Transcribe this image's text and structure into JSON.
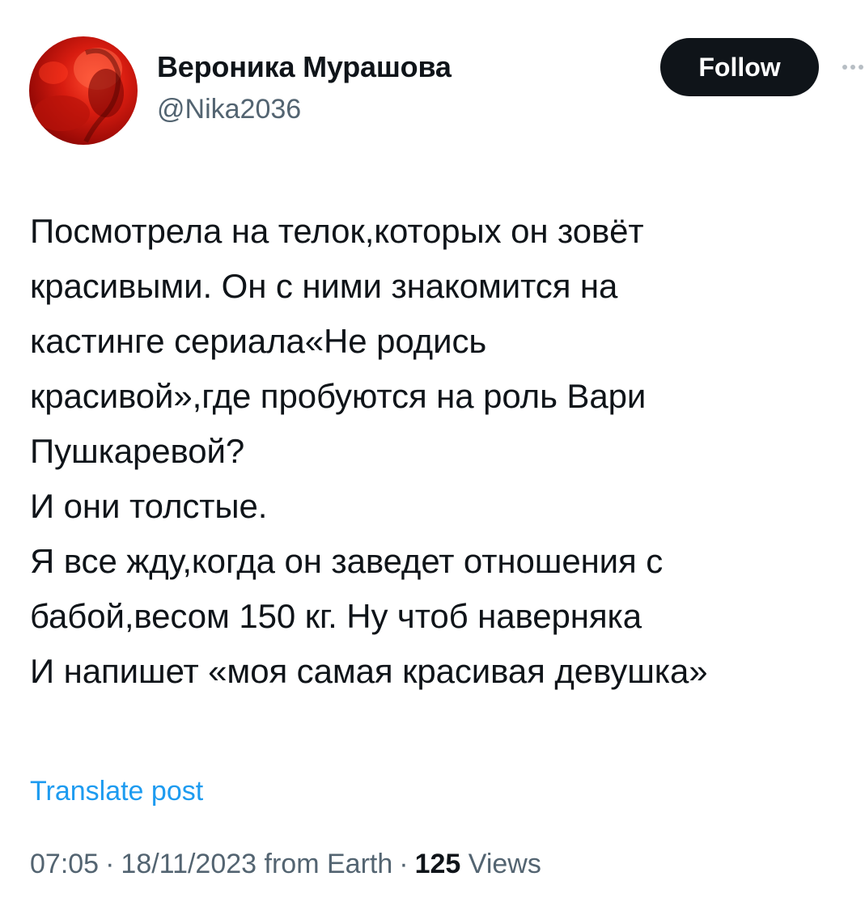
{
  "author": {
    "display_name": "Вероника Мурашова",
    "handle": "@Nika2036",
    "avatar_icon": "avatar-photo-red"
  },
  "actions": {
    "follow_label": "Follow",
    "more_icon": "more-dots-icon"
  },
  "tweet": {
    "lines": [
      "Посмотрела на телок,которых он зовёт",
      "красивыми. Он с ними знакомится на",
      "кастинге сериала«Не родись",
      "красивой»,где пробуются на роль Вари",
      "Пушкаревой?",
      "И они толстые.",
      "Я все жду,когда он заведет отношения с",
      "бабой,весом 150 кг. Ну чтоб наверняка",
      "И напишет «моя самая красивая девушка»"
    ]
  },
  "translate_label": "Translate post",
  "meta": {
    "time": "07:05",
    "date": "18/11/2023",
    "source": "from Earth",
    "separator": "·",
    "views_count": "125",
    "views_label": "Views"
  },
  "colors": {
    "text_primary": "#0f1419",
    "text_secondary": "#536471",
    "link": "#1d9bf0",
    "button_bg": "#0f1419",
    "button_text": "#ffffff",
    "avatar_accent": "#d81c10"
  }
}
